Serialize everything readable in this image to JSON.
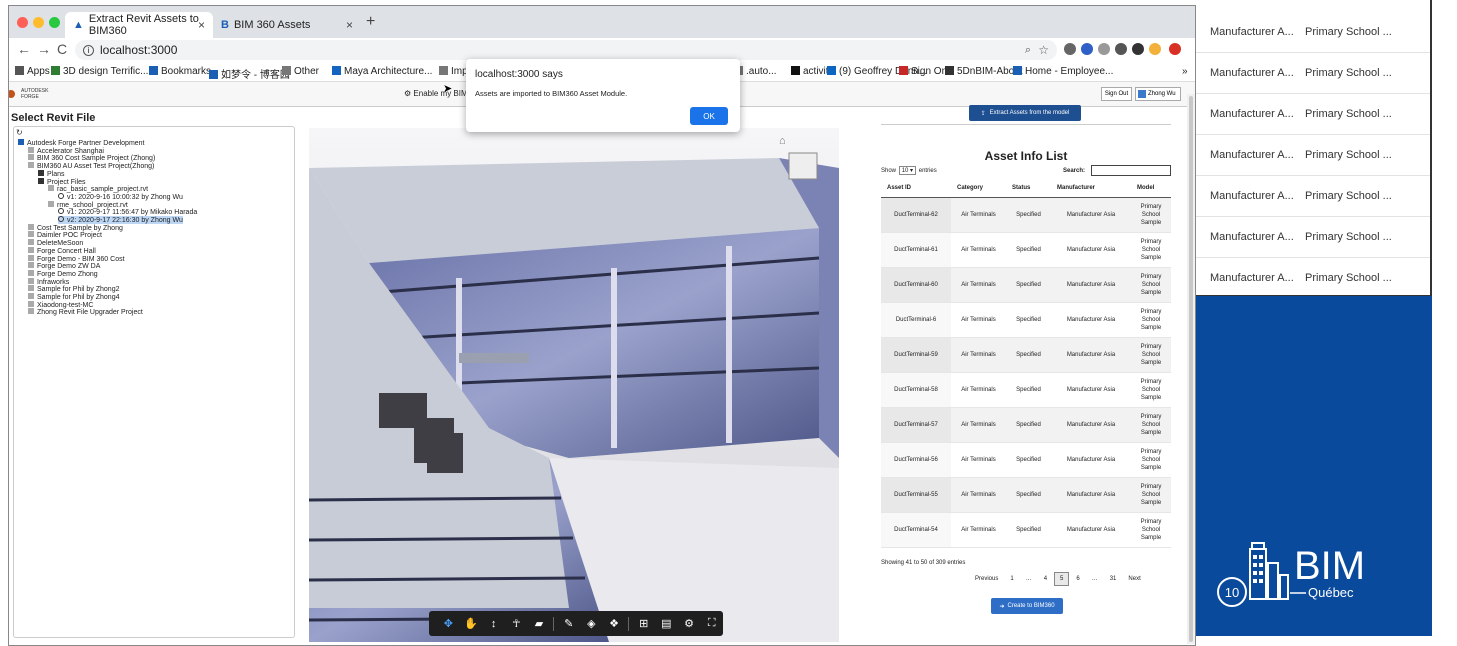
{
  "background_table": {
    "rows": [
      {
        "manufacturer": "Manufacturer A...",
        "model": "Primary School ..."
      },
      {
        "manufacturer": "Manufacturer A...",
        "model": "Primary School ..."
      },
      {
        "manufacturer": "Manufacturer A...",
        "model": "Primary School ..."
      },
      {
        "manufacturer": "Manufacturer A...",
        "model": "Primary School ..."
      },
      {
        "manufacturer": "Manufacturer A...",
        "model": "Primary School ..."
      },
      {
        "manufacturer": "Manufacturer A...",
        "model": "Primary School ..."
      },
      {
        "manufacturer": "Manufacturer A...",
        "model": "Primary School ..."
      }
    ]
  },
  "bim_logo": {
    "number": "10",
    "word": "BIM",
    "sub": "Québec",
    "panel_color": "#0a4a9c"
  },
  "browser": {
    "tabs": [
      {
        "title": "Extract Revit Assets to BIM360"
      },
      {
        "title": "BIM 360 Assets"
      }
    ],
    "close_glyph": "×",
    "new_tab_glyph": "+",
    "url": "localhost:3000",
    "bookmarks": [
      "Apps",
      "3D design Terrific...",
      "Bookmarks",
      "如梦令 - 博客园",
      "Other",
      "Maya Architecture...",
      "Imp",
      ".auto...",
      "activit",
      "(9) Geoffrey Dunn...",
      "Sign On",
      "5DnBIM-About",
      "Home - Employee...",
      "»"
    ]
  },
  "app": {
    "brand_line1": "AUTODESK",
    "brand_line2": "FORGE",
    "enable_text": "Enable my BIM 36",
    "sign_out": "Sign Out",
    "user_name": "Zhong Wu",
    "select_title": "Select Revit File",
    "tree": [
      {
        "label": "Autodesk Forge Partner Development",
        "level": 0
      },
      {
        "label": "Accelerator Shanghai",
        "level": 1
      },
      {
        "label": "BIM 360 Cost Sample Project (Zhong)",
        "level": 1
      },
      {
        "label": "BIM360 AU Asset Test Project(Zhong)",
        "level": 1
      },
      {
        "label": "Plans",
        "level": 2
      },
      {
        "label": "Project Files",
        "level": 2
      },
      {
        "label": "rac_basic_sample_project.rvt",
        "level": 3
      },
      {
        "label": "v1: 2020-9-16 10:00:32 by Zhong Wu",
        "level": 4
      },
      {
        "label": "rme_school_project.rvt",
        "level": 3
      },
      {
        "label": "v1: 2020-9-17 11:56:47 by Mikako Harada",
        "level": 4
      },
      {
        "label": "v2: 2020-9-17 22:16:30 by Zhong Wu",
        "level": 4,
        "selected": true
      },
      {
        "label": "Cost Test Sample by Zhong",
        "level": 1
      },
      {
        "label": "Daimler POC Project",
        "level": 1
      },
      {
        "label": "DeleteMeSoon",
        "level": 1
      },
      {
        "label": "Forge Concert Hall",
        "level": 1
      },
      {
        "label": "Forge Demo - BIM 360 Cost",
        "level": 1
      },
      {
        "label": "Forge Demo ZW DA",
        "level": 1
      },
      {
        "label": "Forge Demo Zhong",
        "level": 1
      },
      {
        "label": "Infraworks",
        "level": 1
      },
      {
        "label": "Sample for Phil by Zhong2",
        "level": 1
      },
      {
        "label": "Sample for Phil by Zhong4",
        "level": 1
      },
      {
        "label": "Xiaodong-test-MC",
        "level": 1
      },
      {
        "label": "Zhong Revit File Upgrader Project",
        "level": 1
      }
    ]
  },
  "assets": {
    "extract_button": "Extract Assets from the model",
    "title": "Asset Info List",
    "show_label": "Show",
    "entries_value": "10",
    "entries_label": "entries",
    "search_label": "Search:",
    "search_value": "",
    "columns": [
      "Asset ID",
      "Category",
      "Status",
      "Manufacturer",
      "Model"
    ],
    "rows": [
      {
        "id": "DuctTerminal-62",
        "category": "Air Terminals",
        "status": "Specified",
        "manufacturer": "Manufacturer Asia",
        "model": [
          "Primary",
          "School",
          "Sample"
        ]
      },
      {
        "id": "DuctTerminal-61",
        "category": "Air Terminals",
        "status": "Specified",
        "manufacturer": "Manufacturer Asia",
        "model": [
          "Primary",
          "School",
          "Sample"
        ]
      },
      {
        "id": "DuctTerminal-60",
        "category": "Air Terminals",
        "status": "Specified",
        "manufacturer": "Manufacturer Asia",
        "model": [
          "Primary",
          "School",
          "Sample"
        ]
      },
      {
        "id": "DuctTerminal-6",
        "category": "Air Terminals",
        "status": "Specified",
        "manufacturer": "Manufacturer Asia",
        "model": [
          "Primary",
          "School",
          "Sample"
        ]
      },
      {
        "id": "DuctTerminal-59",
        "category": "Air Terminals",
        "status": "Specified",
        "manufacturer": "Manufacturer Asia",
        "model": [
          "Primary",
          "School",
          "Sample"
        ]
      },
      {
        "id": "DuctTerminal-58",
        "category": "Air Terminals",
        "status": "Specified",
        "manufacturer": "Manufacturer Asia",
        "model": [
          "Primary",
          "School",
          "Sample"
        ]
      },
      {
        "id": "DuctTerminal-57",
        "category": "Air Terminals",
        "status": "Specified",
        "manufacturer": "Manufacturer Asia",
        "model": [
          "Primary",
          "School",
          "Sample"
        ]
      },
      {
        "id": "DuctTerminal-56",
        "category": "Air Terminals",
        "status": "Specified",
        "manufacturer": "Manufacturer Asia",
        "model": [
          "Primary",
          "School",
          "Sample"
        ]
      },
      {
        "id": "DuctTerminal-55",
        "category": "Air Terminals",
        "status": "Specified",
        "manufacturer": "Manufacturer Asia",
        "model": [
          "Primary",
          "School",
          "Sample"
        ]
      },
      {
        "id": "DuctTerminal-54",
        "category": "Air Terminals",
        "status": "Specified",
        "manufacturer": "Manufacturer Asia",
        "model": [
          "Primary",
          "School",
          "Sample"
        ]
      }
    ],
    "showing": "Showing 41 to 50 of 309 entries",
    "pager": [
      "Previous",
      "1",
      "…",
      "4",
      "5",
      "6",
      "…",
      "31",
      "Next"
    ],
    "current_page": "5",
    "create_button": "Create to BIM360"
  },
  "alert": {
    "title": "localhost:3000 says",
    "message": "Assets are imported to BIM360 Asset Module.",
    "ok": "OK"
  },
  "colors": {
    "accent_blue": "#1a73e8",
    "forge_blue": "#1d4f91"
  }
}
